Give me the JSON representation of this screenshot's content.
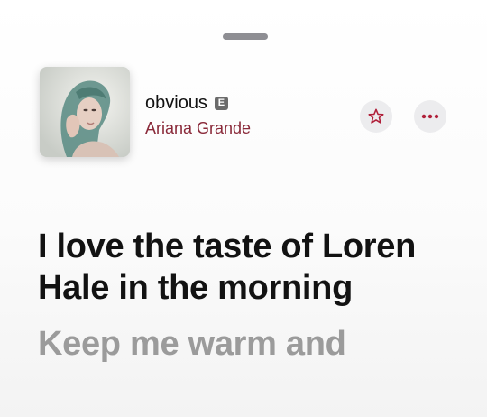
{
  "now_playing": {
    "title": "obvious",
    "explicit_badge": "E",
    "artist": "Ariana Grande",
    "artwork_icon": "album-artwork-image",
    "star_icon": "star-icon",
    "more_icon": "ellipsis-icon"
  },
  "lyrics": {
    "current_line": "I love the taste of Loren Hale in the morning",
    "next_line": "Keep me warm and"
  },
  "colors": {
    "artist": "#8a2a3a",
    "accent": "#b0203a",
    "button_bg": "#ececee",
    "active_lyric": "#121212",
    "inactive_lyric": "#9b9b9b"
  }
}
